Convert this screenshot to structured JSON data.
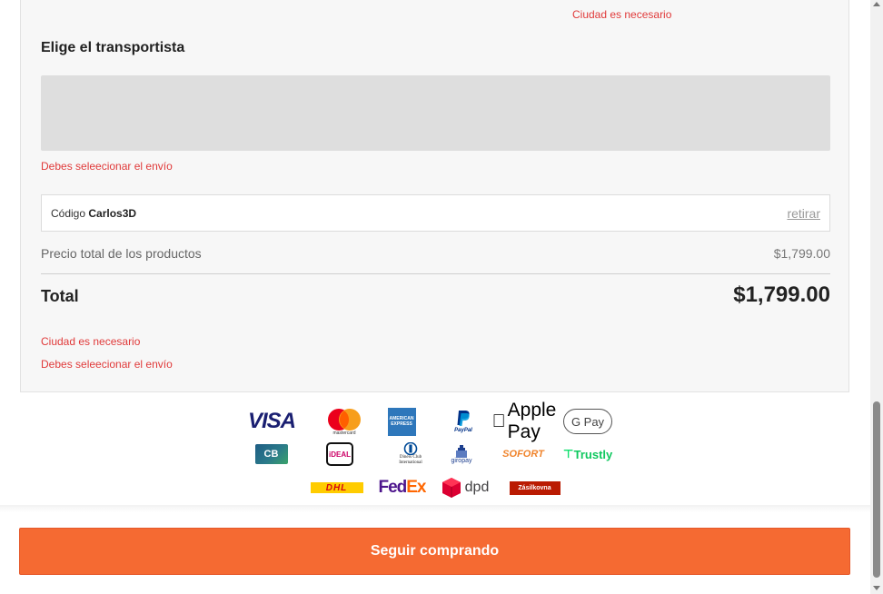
{
  "colors": {
    "accent": "#f56a32",
    "error": "#e03a3a",
    "panel_bg": "#f7f7f7"
  },
  "errors": {
    "city_required": "Ciudad es necesario",
    "shipping_required": "Debes seleecionar el envío"
  },
  "carrier": {
    "title": "Elige el transportista"
  },
  "coupon": {
    "label": "Código",
    "code": "Carlos3D",
    "remove_label": "retirar"
  },
  "summary": {
    "subtotal_label": "Precio total de los productos",
    "subtotal_value": "$1,799.00",
    "total_label": "Total",
    "total_value": "$1,799.00"
  },
  "payment_logos": {
    "row1": [
      "VISA",
      "mastercard",
      "AMERICAN EXPRESS",
      "PayPal",
      "Apple Pay",
      "G Pay"
    ],
    "row2": [
      "CB",
      "iDEAL",
      "Diners Club International",
      "giropay",
      "SOFORT",
      "Trustly"
    ],
    "row3": [
      "DHL",
      "FedEx",
      "dpd",
      "Zásilkovna"
    ]
  },
  "footer": {
    "continue_label": "Seguir comprando"
  }
}
